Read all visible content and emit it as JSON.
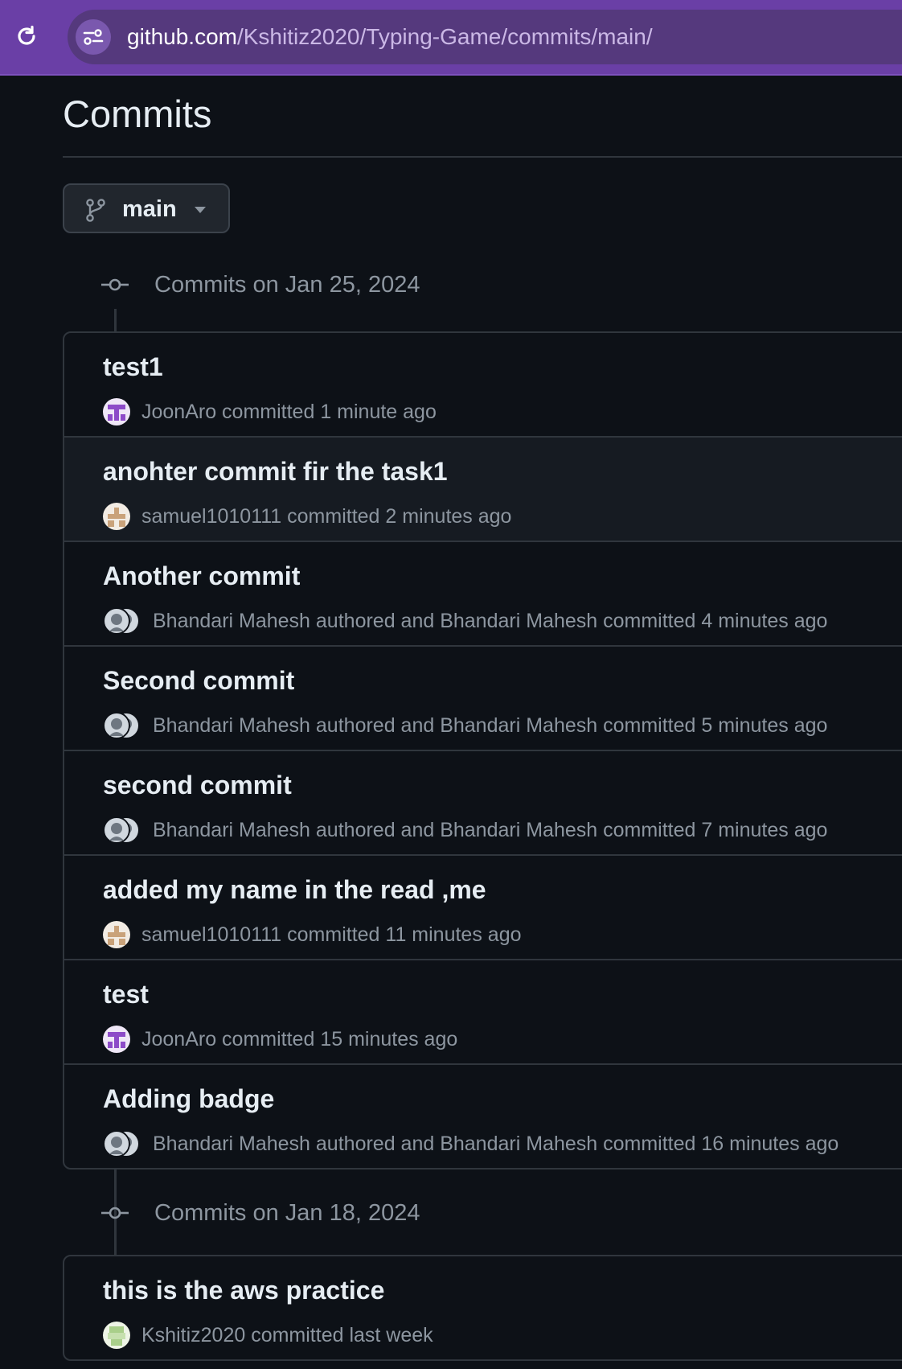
{
  "browser": {
    "url_host": "github.com",
    "url_path": "/Kshitiz2020/Typing-Game/commits/main/",
    "colors": {
      "bar": "#6a3fa6",
      "omnibox": "#55397d"
    }
  },
  "page": {
    "title": "Commits",
    "branch": "main"
  },
  "groups": [
    {
      "label": "Commits on Jan 25, 2024",
      "commits": [
        {
          "title": "test1",
          "meta": "JoonAro committed 1 minute ago",
          "avatar": "joonaro"
        },
        {
          "title": "anohter commit fir the task1",
          "meta": "samuel1010111 committed 2 minutes ago",
          "avatar": "samuel"
        },
        {
          "title": "Another commit",
          "meta": "Bhandari Mahesh authored and Bhandari Mahesh committed 4 minutes ago",
          "avatar": "pair"
        },
        {
          "title": "Second commit",
          "meta": "Bhandari Mahesh authored and Bhandari Mahesh committed 5 minutes ago",
          "avatar": "pair"
        },
        {
          "title": "second commit",
          "meta": "Bhandari Mahesh authored and Bhandari Mahesh committed 7 minutes ago",
          "avatar": "pair"
        },
        {
          "title": "added my name in the read ,me",
          "meta": "samuel1010111 committed 11 minutes ago",
          "avatar": "samuel"
        },
        {
          "title": "test",
          "meta": "JoonAro committed 15 minutes ago",
          "avatar": "joonaro"
        },
        {
          "title": "Adding badge",
          "meta": "Bhandari Mahesh authored and Bhandari Mahesh committed 16 minutes ago",
          "avatar": "pair"
        }
      ]
    },
    {
      "label": "Commits on Jan 18, 2024",
      "commits": [
        {
          "title": "this is the aws practice",
          "meta": "Kshitiz2020 committed last week",
          "avatar": "kshitiz"
        }
      ]
    }
  ]
}
